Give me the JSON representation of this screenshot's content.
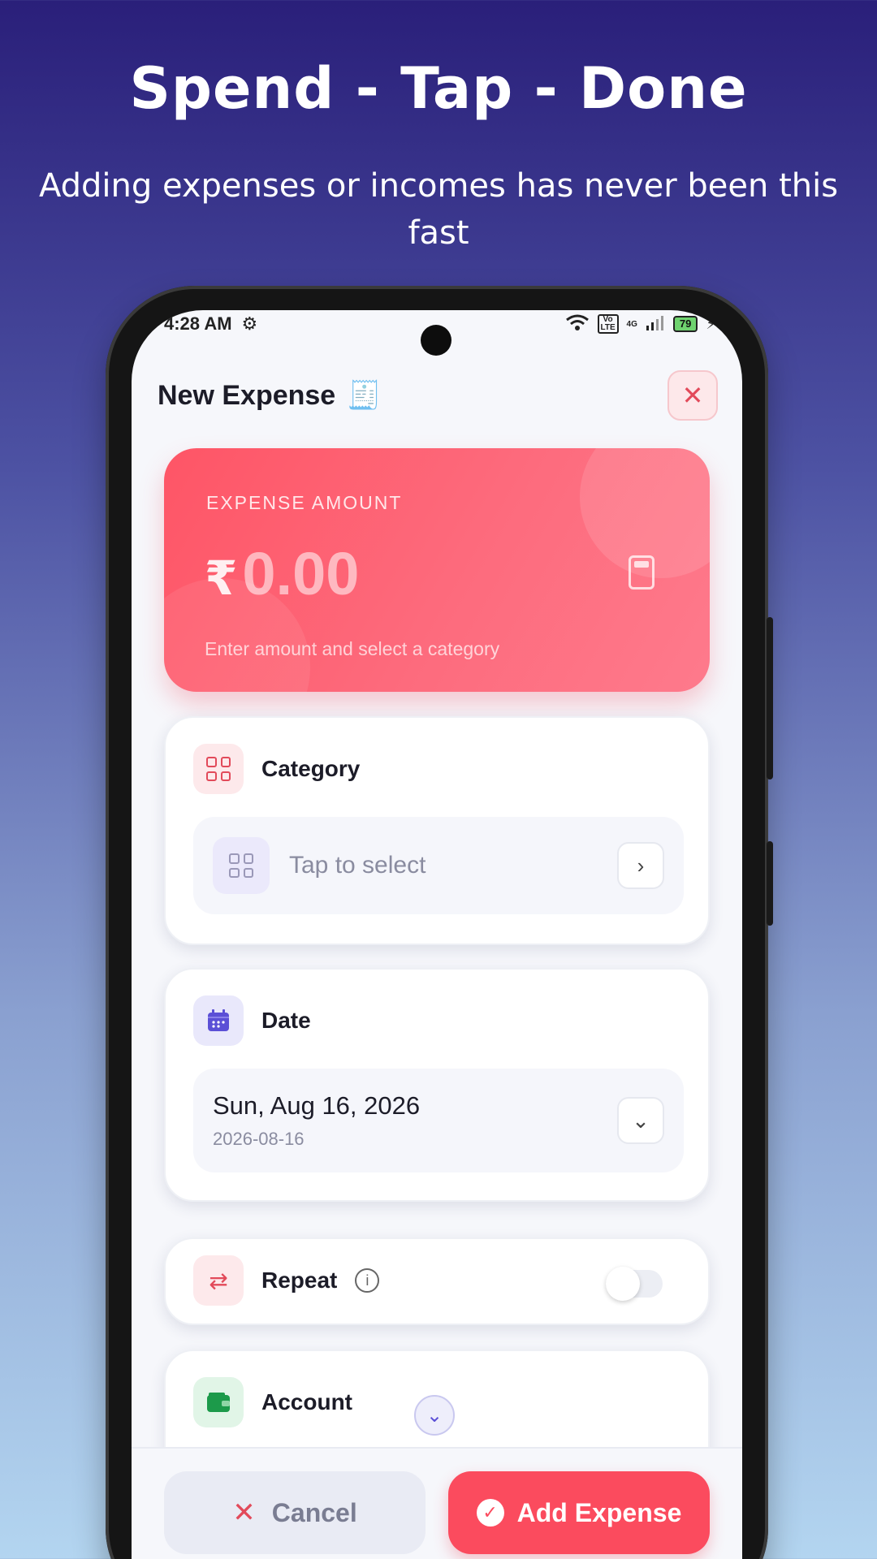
{
  "promo": {
    "headline": "Spend - Tap - Done",
    "subheadline": "Adding expenses or incomes has never been this fast"
  },
  "status_bar": {
    "time": "4:28 AM",
    "network_label": "Vo LTE",
    "signal_label": "4G",
    "battery": "79"
  },
  "header": {
    "title": "New Expense",
    "title_icon": "receipt-icon",
    "close_icon": "close-icon"
  },
  "amount_card": {
    "label": "EXPENSE AMOUNT",
    "currency": "₹",
    "value": "0.00",
    "hint": "Enter amount and select a category",
    "icon": "calculator-icon"
  },
  "category": {
    "label": "Category",
    "placeholder": "Tap to select"
  },
  "date": {
    "label": "Date",
    "display": "Sun, Aug 16, 2026",
    "iso": "2026-08-16"
  },
  "repeat": {
    "label": "Repeat",
    "enabled": false
  },
  "account": {
    "label": "Account"
  },
  "actions": {
    "cancel_label": "Cancel",
    "add_label": "Add Expense"
  },
  "colors": {
    "accent": "#fb4b5e",
    "date_icon": "#5b4fd6",
    "account_icon": "#1c9a4a"
  }
}
